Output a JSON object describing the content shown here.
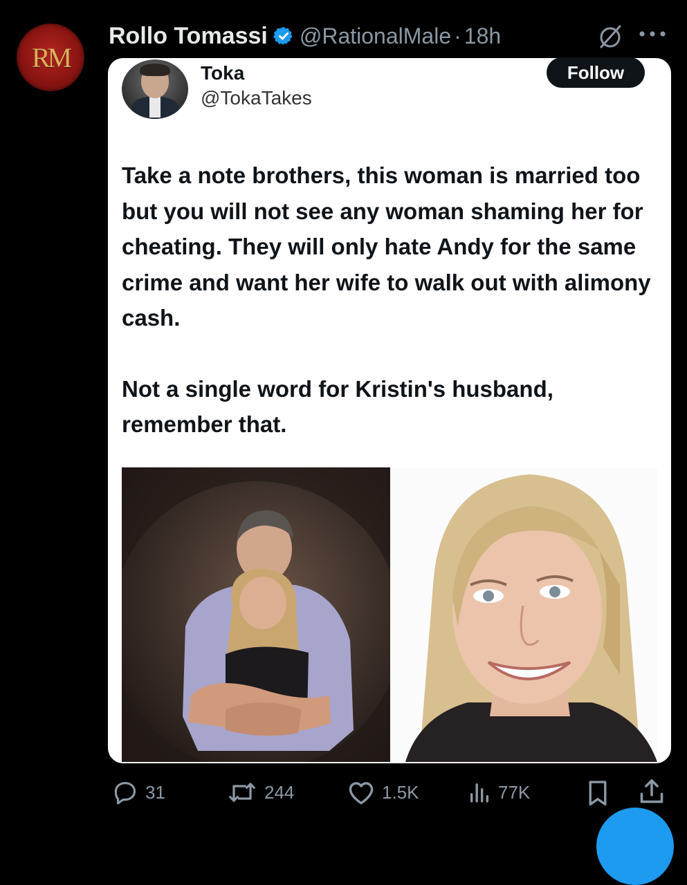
{
  "tweet": {
    "avatar_initials": "RM",
    "author_name": "Rollo Tomassi",
    "author_handle": "@RationalMale",
    "separator": "·",
    "time": "18h"
  },
  "quote": {
    "name": "Toka",
    "handle": "@TokaTakes",
    "follow_label": "Follow",
    "paragraphs": [
      "Take a note brothers, this woman is married too but you will not see any woman shaming her for cheating. They will only hate Andy for the same crime and want her wife to walk out with alimony cash.",
      "Not a single word for Kristin's husband, remember that."
    ]
  },
  "actions": {
    "replies": "31",
    "reposts": "244",
    "likes": "1.5K",
    "views": "77K"
  },
  "colors": {
    "background": "#000000",
    "text": "#e7e9ea",
    "muted": "#8b98a5",
    "verified": "#1d9bf0",
    "card": "#ffffff"
  }
}
